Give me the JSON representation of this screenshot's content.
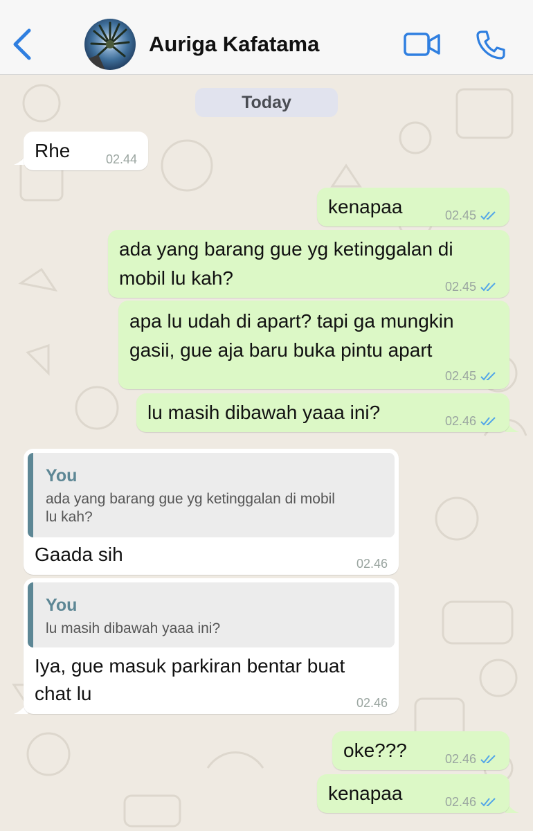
{
  "header": {
    "contact_name": "Auriga Kafatama",
    "back_icon": "chevron-left-icon",
    "video_icon": "video-camera-icon",
    "call_icon": "phone-icon",
    "accent_color": "#2f7fe0"
  },
  "chat": {
    "date_label": "Today",
    "messages": [
      {
        "direction": "in",
        "text": "Rhe",
        "time": "02.44"
      },
      {
        "direction": "out",
        "text": "kenapaa",
        "time": "02.45",
        "status": "read"
      },
      {
        "direction": "out",
        "text_lines": [
          "ada yang barang gue yg ketinggalan di",
          "mobil lu kah?"
        ],
        "time": "02.45",
        "status": "read"
      },
      {
        "direction": "out",
        "text_lines": [
          "apa lu udah di apart? tapi ga mungkin",
          "gasii, gue aja baru buka pintu apart"
        ],
        "time": "02.45",
        "status": "read"
      },
      {
        "direction": "out",
        "text": "lu masih dibawah yaaa ini?",
        "time": "02.46",
        "status": "read"
      },
      {
        "direction": "in",
        "reply_to": {
          "author": "You",
          "text_lines": [
            "ada yang barang gue yg ketinggalan di mobil",
            "lu kah?"
          ]
        },
        "text": "Gaada sih",
        "time": "02.46"
      },
      {
        "direction": "in",
        "reply_to": {
          "author": "You",
          "text_lines": [
            "lu masih dibawah yaaa ini?"
          ]
        },
        "text_lines": [
          "Iya, gue masuk parkiran bentar buat",
          "chat lu"
        ],
        "time": "02.46"
      },
      {
        "direction": "out",
        "text": "oke???",
        "time": "02.46",
        "status": "read"
      },
      {
        "direction": "out",
        "text": "kenapaa",
        "time": "02.46",
        "status": "read"
      }
    ]
  },
  "colors": {
    "incoming_bubble": "#ffffff",
    "outgoing_bubble": "#dcf8c6",
    "wallpaper": "#efeae2",
    "read_ticks": "#53a6e8",
    "quote_accent": "#5d8795"
  }
}
